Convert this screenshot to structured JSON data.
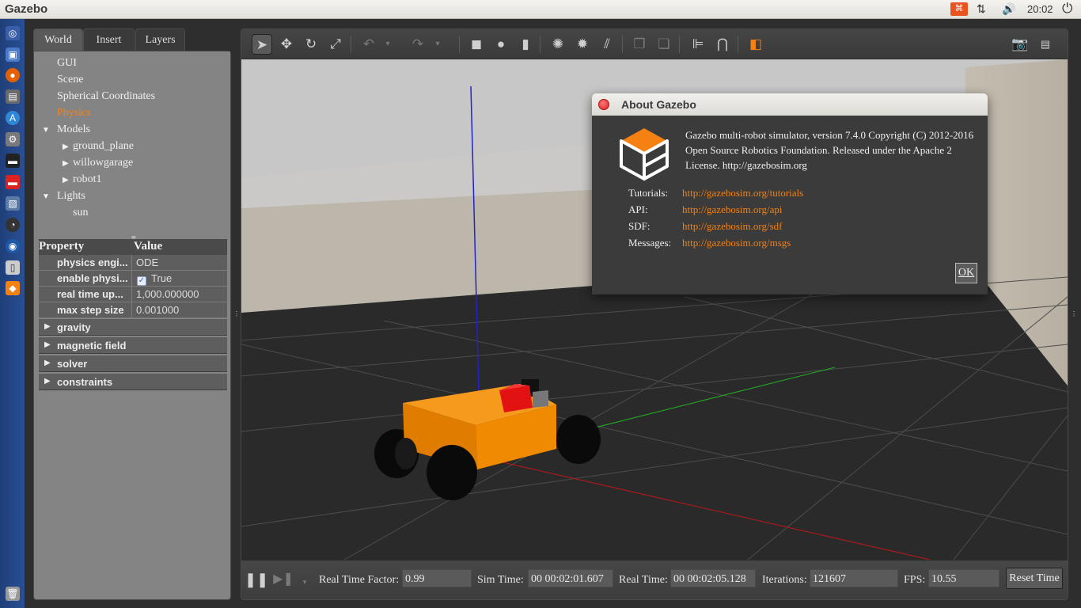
{
  "topbar": {
    "app_title": "Gazebo",
    "input_method": "⌘",
    "clock": "20:02"
  },
  "left_panel": {
    "tabs": [
      {
        "label": "World"
      },
      {
        "label": "Insert"
      },
      {
        "label": "Layers"
      }
    ],
    "tree": {
      "gui": "GUI",
      "scene": "Scene",
      "spherical": "Spherical Coordinates",
      "physics": "Physics",
      "models": "Models",
      "model_items": [
        "ground_plane",
        "willowgarage",
        "robot1"
      ],
      "lights": "Lights",
      "light_items": [
        "sun"
      ]
    },
    "properties": {
      "header_property": "Property",
      "header_value": "Value",
      "rows": [
        {
          "key": "physics engi...",
          "value": "ODE"
        },
        {
          "key": "enable physi...",
          "value": "True"
        },
        {
          "key": "real time up...",
          "value": "1,000.000000"
        },
        {
          "key": "max step size",
          "value": "0.001000"
        }
      ],
      "groups": [
        "gravity",
        "magnetic field",
        "solver",
        "constraints"
      ]
    }
  },
  "bottombar": {
    "rtf_label": "Real Time Factor:",
    "rtf_value": "0.99",
    "sim_label": "Sim Time:",
    "sim_value": "00 00:02:01.607",
    "real_label": "Real Time:",
    "real_value": "00 00:02:05.128",
    "iter_label": "Iterations:",
    "iter_value": "121607",
    "fps_label": "FPS:",
    "fps_value": "10.55",
    "reset_label": "Reset Time"
  },
  "about": {
    "title": "About Gazebo",
    "description": "Gazebo multi-robot simulator, version 7.4.0 Copyright (C) 2012-2016 Open Source Robotics Foundation. Released under the Apache 2 License. http://gazebosim.org",
    "links": [
      {
        "label": "Tutorials:",
        "url": "http://gazebosim.org/tutorials"
      },
      {
        "label": "API:",
        "url": "http://gazebosim.org/api"
      },
      {
        "label": "SDF:",
        "url": "http://gazebosim.org/sdf"
      },
      {
        "label": "Messages:",
        "url": "http://gazebosim.org/msgs"
      }
    ],
    "ok_label": "OK"
  },
  "colors": {
    "accent": "#f58113",
    "launcher": "#2a4f94",
    "robot_body": "#f08a00"
  }
}
